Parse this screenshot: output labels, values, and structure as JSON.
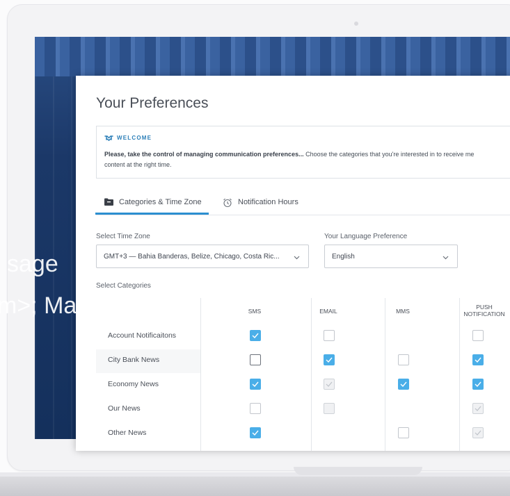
{
  "overlay": {
    "line1": "sage",
    "line2": "m>; Maya"
  },
  "page": {
    "title": "Your Preferences"
  },
  "welcome": {
    "tag": "WELCOME",
    "bold": "Please, take the control of managing communication preferences...",
    "line1_rest": " Choose the categories that you're interested in to receive me",
    "line2": "content at the right time."
  },
  "tabs": [
    {
      "label": "Categories & Time Zone",
      "active": true,
      "icon": "folder-icon"
    },
    {
      "label": "Notification Hours",
      "active": false,
      "icon": "alarm-clock-icon"
    }
  ],
  "timezone": {
    "label": "Select Time Zone",
    "value": "GMT+3 — Bahia Banderas, Belize, Chicago, Costa Ric..."
  },
  "language": {
    "label": "Your Language Preference",
    "value": "English"
  },
  "categories": {
    "label": "Select Categories",
    "columns": [
      "SMS",
      "EMAIL",
      "MMS",
      "PUSH\nNOTIFICATION"
    ],
    "rows": [
      {
        "name": "Account Notificaitons",
        "states": [
          "checked",
          "unchecked",
          "none",
          "unchecked"
        ]
      },
      {
        "name": "City Bank News",
        "states": [
          "strong",
          "checked",
          "unchecked",
          "checked"
        ]
      },
      {
        "name": "Economy News",
        "states": [
          "checked",
          "disabled-checked",
          "checked",
          "checked"
        ]
      },
      {
        "name": "Our News",
        "states": [
          "unchecked",
          "disabled",
          "none",
          "disabled-checked"
        ]
      },
      {
        "name": "Other News",
        "states": [
          "checked",
          "none",
          "unchecked",
          "disabled-checked"
        ]
      }
    ]
  },
  "colors": {
    "accent": "#2c8fd0",
    "checkbox": "#4aaee8",
    "welcome": "#2c7fb8"
  }
}
